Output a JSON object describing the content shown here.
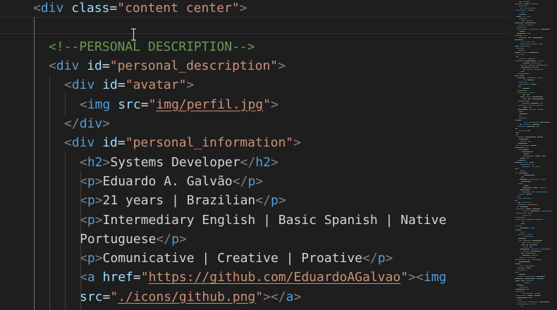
{
  "editor": {
    "language": "html",
    "lines": [
      {
        "indent": 2,
        "tokens": [
          [
            "br",
            "<"
          ],
          [
            "tag",
            "div"
          ],
          [
            "txt",
            " "
          ],
          [
            "attr",
            "class"
          ],
          [
            "eq",
            "="
          ],
          [
            "str",
            "\"content center\""
          ],
          [
            "br",
            ">"
          ]
        ]
      },
      {
        "indent": 0,
        "tokens": []
      },
      {
        "indent": 3,
        "tokens": [
          [
            "com",
            "<!--PERSONAL DESCRIPTION-->"
          ]
        ]
      },
      {
        "indent": 3,
        "tokens": [
          [
            "br",
            "<"
          ],
          [
            "tag",
            "div"
          ],
          [
            "txt",
            " "
          ],
          [
            "attr",
            "id"
          ],
          [
            "eq",
            "="
          ],
          [
            "str",
            "\"personal_description\""
          ],
          [
            "br",
            ">"
          ]
        ]
      },
      {
        "indent": 4,
        "tokens": [
          [
            "br",
            "<"
          ],
          [
            "tag",
            "div"
          ],
          [
            "txt",
            " "
          ],
          [
            "attr",
            "id"
          ],
          [
            "eq",
            "="
          ],
          [
            "str",
            "\"avatar\""
          ],
          [
            "br",
            ">"
          ]
        ]
      },
      {
        "indent": 5,
        "tokens": [
          [
            "br",
            "<"
          ],
          [
            "tag",
            "img"
          ],
          [
            "txt",
            " "
          ],
          [
            "attr",
            "src"
          ],
          [
            "eq",
            "="
          ],
          [
            "str",
            "\""
          ],
          [
            "link",
            "img/perfil.jpg"
          ],
          [
            "str",
            "\""
          ],
          [
            "br",
            ">"
          ]
        ]
      },
      {
        "indent": 4,
        "tokens": [
          [
            "br",
            "</"
          ],
          [
            "tag",
            "div"
          ],
          [
            "br",
            ">"
          ]
        ]
      },
      {
        "indent": 4,
        "tokens": [
          [
            "br",
            "<"
          ],
          [
            "tag",
            "div"
          ],
          [
            "txt",
            " "
          ],
          [
            "attr",
            "id"
          ],
          [
            "eq",
            "="
          ],
          [
            "str",
            "\"personal_information\""
          ],
          [
            "br",
            ">"
          ]
        ]
      },
      {
        "indent": 5,
        "tokens": [
          [
            "br",
            "<"
          ],
          [
            "tag",
            "h2"
          ],
          [
            "br",
            ">"
          ],
          [
            "txt",
            "Systems Developer"
          ],
          [
            "br",
            "</"
          ],
          [
            "tag",
            "h2"
          ],
          [
            "br",
            ">"
          ]
        ]
      },
      {
        "indent": 5,
        "tokens": [
          [
            "br",
            "<"
          ],
          [
            "tag",
            "p"
          ],
          [
            "br",
            ">"
          ],
          [
            "txt",
            "Eduardo A. Galvão"
          ],
          [
            "br",
            "</"
          ],
          [
            "tag",
            "p"
          ],
          [
            "br",
            ">"
          ]
        ]
      },
      {
        "indent": 5,
        "tokens": [
          [
            "br",
            "<"
          ],
          [
            "tag",
            "p"
          ],
          [
            "br",
            ">"
          ],
          [
            "txt",
            "21 years | Brazilian"
          ],
          [
            "br",
            "</"
          ],
          [
            "tag",
            "p"
          ],
          [
            "br",
            ">"
          ]
        ]
      },
      {
        "indent": 5,
        "tokens": [
          [
            "br",
            "<"
          ],
          [
            "tag",
            "p"
          ],
          [
            "br",
            ">"
          ],
          [
            "txt",
            "Intermediary English | Basic Spanish | Native"
          ]
        ]
      },
      {
        "indent": 5,
        "tokens": [
          [
            "txt",
            "Portuguese"
          ],
          [
            "br",
            "</"
          ],
          [
            "tag",
            "p"
          ],
          [
            "br",
            ">"
          ]
        ]
      },
      {
        "indent": 5,
        "tokens": [
          [
            "br",
            "<"
          ],
          [
            "tag",
            "p"
          ],
          [
            "br",
            ">"
          ],
          [
            "txt",
            "Comunicative | Creative | Proative"
          ],
          [
            "br",
            "</"
          ],
          [
            "tag",
            "p"
          ],
          [
            "br",
            ">"
          ]
        ]
      },
      {
        "indent": 5,
        "tokens": [
          [
            "br",
            "<"
          ],
          [
            "tag",
            "a"
          ],
          [
            "txt",
            " "
          ],
          [
            "attr",
            "href"
          ],
          [
            "eq",
            "="
          ],
          [
            "str",
            "\""
          ],
          [
            "link",
            "https://github.com/EduardoAGalvao"
          ],
          [
            "str",
            "\""
          ],
          [
            "br",
            "><"
          ],
          [
            "tag",
            "img"
          ]
        ]
      },
      {
        "indent": 5,
        "tokens": [
          [
            "attr",
            "src"
          ],
          [
            "eq",
            "="
          ],
          [
            "str",
            "\""
          ],
          [
            "link",
            "./icons/github.png"
          ],
          [
            "str",
            "\""
          ],
          [
            "br",
            "></"
          ],
          [
            "tag",
            "a"
          ],
          [
            "br",
            ">"
          ]
        ]
      }
    ]
  },
  "colors": {
    "background": "#1e1e1e",
    "tag": "#569cd6",
    "attribute": "#9cdcfe",
    "string": "#ce9178",
    "comment": "#6a9955",
    "text": "#d4d4d4",
    "bracket": "#808080"
  },
  "icons": {
    "cursor": "ibeam-cursor-icon"
  }
}
